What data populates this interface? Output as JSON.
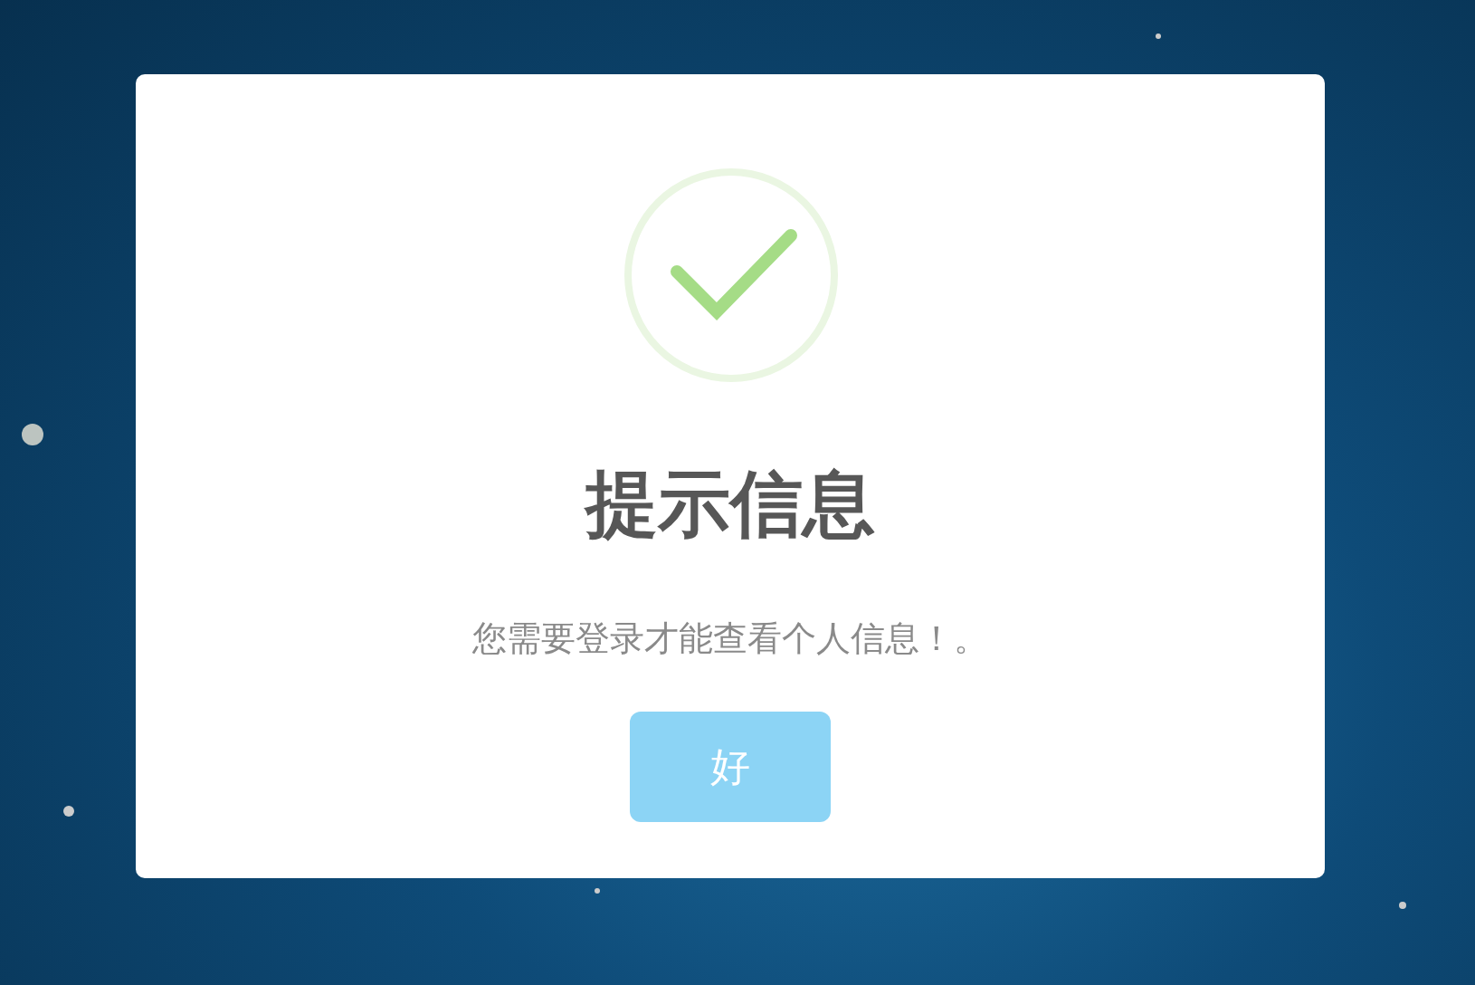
{
  "dialog": {
    "kind": "success",
    "title": "提示信息",
    "message": "您需要登录才能查看个人信息！。",
    "buttons": [
      {
        "label": "好"
      }
    ]
  }
}
